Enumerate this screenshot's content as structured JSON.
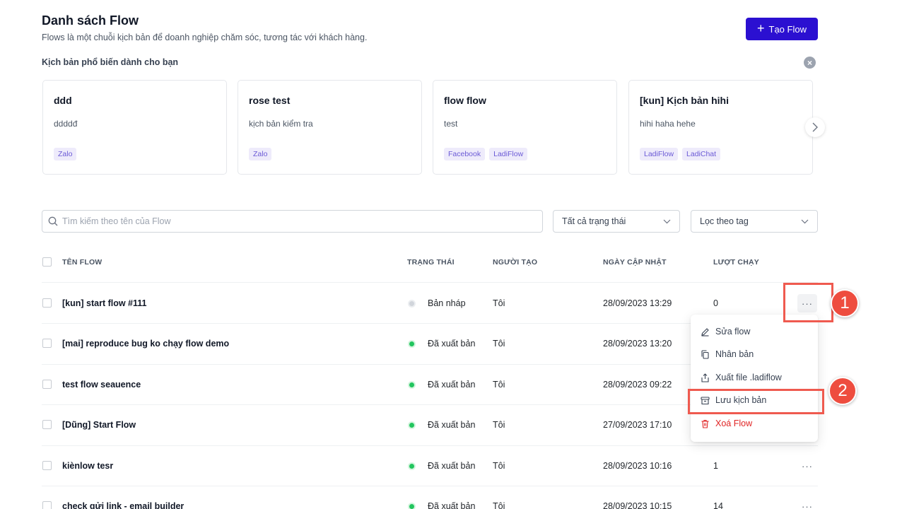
{
  "header": {
    "title": "Danh sách Flow",
    "subtitle": "Flows là một chuỗi kịch bản để doanh nghiệp chăm sóc, tương tác với khách hàng.",
    "create_button": "Tạo Flow"
  },
  "templates": {
    "section_title": "Kịch bản phổ biến dành cho bạn",
    "cards": [
      {
        "title": "ddd",
        "desc": "ddddđ",
        "tags": [
          "Zalo"
        ]
      },
      {
        "title": "rose test",
        "desc": "kịch bản kiểm tra",
        "tags": [
          "Zalo"
        ]
      },
      {
        "title": "flow flow",
        "desc": "test",
        "tags": [
          "Facebook",
          "LadiFlow"
        ]
      },
      {
        "title": "[kun] Kịch bản hihi",
        "desc": "hihi haha hehe",
        "tags": [
          "LadiFlow",
          "LadiChat"
        ]
      }
    ]
  },
  "filters": {
    "search_placeholder": "Tìm kiếm theo tên của Flow",
    "status_select": "Tất cả trạng thái",
    "tag_select": "Lọc theo tag"
  },
  "table": {
    "columns": [
      "TÊN FLOW",
      "TRẠNG THÁI",
      "NGƯỜI TẠO",
      "NGÀY CẬP NHẬT",
      "LƯỢT CHẠY"
    ],
    "rows": [
      {
        "name": "[kun] start flow #111",
        "status": "Bản nháp",
        "status_type": "draft",
        "creator": "Tôi",
        "updated": "28/09/2023 13:29",
        "runs": "0"
      },
      {
        "name": "[mai] reproduce bug ko chạy flow demo",
        "status": "Đã xuất bản",
        "status_type": "published",
        "creator": "Tôi",
        "updated": "28/09/2023 13:20",
        "runs": ""
      },
      {
        "name": "test flow seauence",
        "status": "Đã xuất bản",
        "status_type": "published",
        "creator": "Tôi",
        "updated": "28/09/2023 09:22",
        "runs": ""
      },
      {
        "name": "[Dũng] Start Flow",
        "status": "Đã xuất bản",
        "status_type": "published",
        "creator": "Tôi",
        "updated": "27/09/2023 17:10",
        "runs": ""
      },
      {
        "name": "kiènlow tesr",
        "status": "Đã xuất bản",
        "status_type": "published",
        "creator": "Tôi",
        "updated": "28/09/2023 10:16",
        "runs": "1"
      },
      {
        "name": "check gửi link - email builder",
        "status": "Đã xuất bản",
        "status_type": "published",
        "creator": "Tôi",
        "updated": "28/09/2023 10:15",
        "runs": "14"
      }
    ]
  },
  "context_menu": {
    "items": [
      "Sửa flow",
      "Nhân bản",
      "Xuất file .ladiflow",
      "Lưu kịch bản",
      "Xoá Flow"
    ]
  },
  "annotations": {
    "badge_1": "1",
    "badge_2": "2",
    "color": "#ee4d3f"
  },
  "colors": {
    "primary": "#2b10d1",
    "published": "#22c55e",
    "draft": "#d1d5db",
    "danger": "#e02424"
  }
}
